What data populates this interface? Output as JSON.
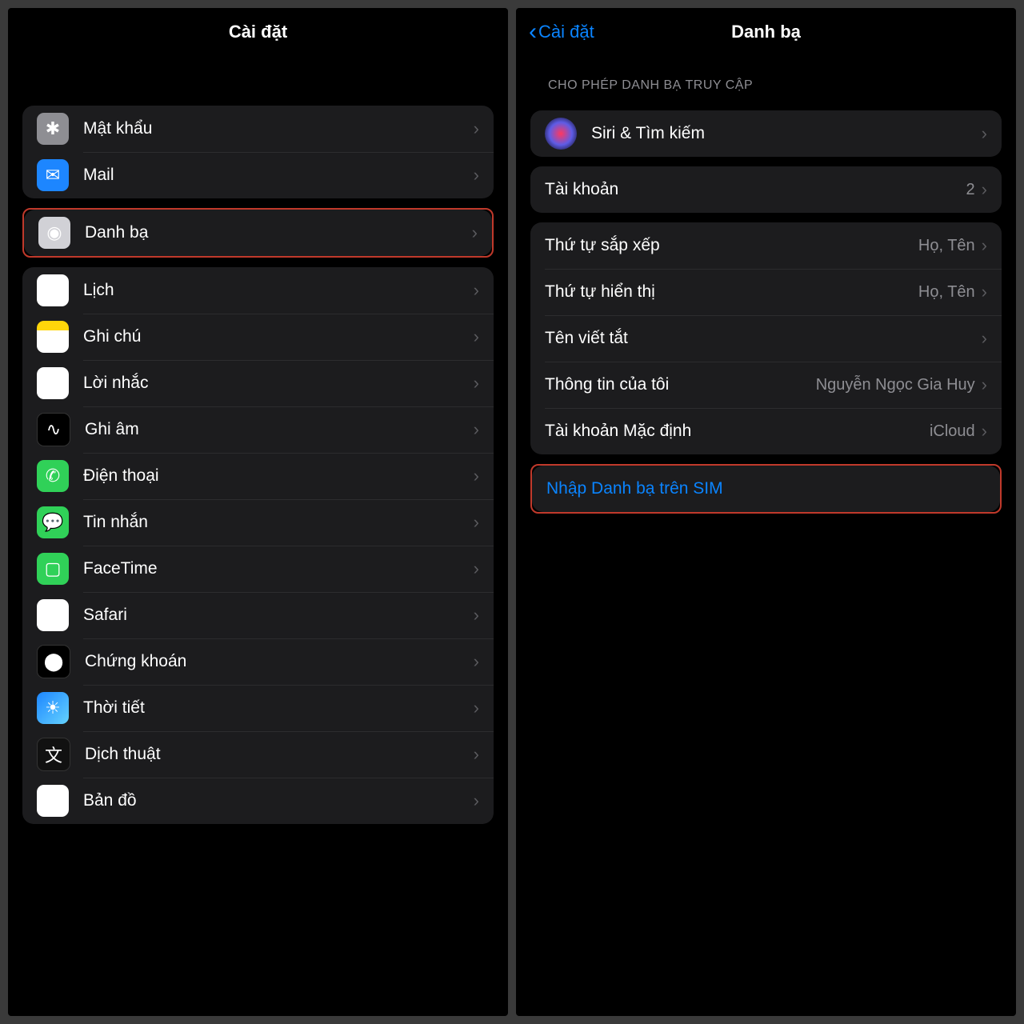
{
  "left": {
    "title": "Cài đặt",
    "items": [
      {
        "label": "Mật khẩu",
        "icon": "key-icon",
        "cls": "ic-pw",
        "glyph": "✱"
      },
      {
        "label": "Mail",
        "icon": "mail-icon",
        "cls": "ic-mail",
        "glyph": "✉"
      },
      {
        "label": "Danh bạ",
        "icon": "contacts-icon",
        "cls": "ic-contacts",
        "glyph": "◉",
        "highlight": true
      },
      {
        "label": "Lịch",
        "icon": "calendar-icon",
        "cls": "ic-cal",
        "glyph": "▦"
      },
      {
        "label": "Ghi chú",
        "icon": "notes-icon",
        "cls": "ic-notes",
        "glyph": ""
      },
      {
        "label": "Lời nhắc",
        "icon": "reminders-icon",
        "cls": "ic-rem",
        "glyph": "☰"
      },
      {
        "label": "Ghi âm",
        "icon": "voicememos-icon",
        "cls": "ic-voice",
        "glyph": "∿"
      },
      {
        "label": "Điện thoại",
        "icon": "phone-icon",
        "cls": "ic-phone",
        "glyph": "✆"
      },
      {
        "label": "Tin nhắn",
        "icon": "messages-icon",
        "cls": "ic-msg",
        "glyph": "💬"
      },
      {
        "label": "FaceTime",
        "icon": "facetime-icon",
        "cls": "ic-ft",
        "glyph": "▢"
      },
      {
        "label": "Safari",
        "icon": "safari-icon",
        "cls": "ic-safari",
        "glyph": "✪"
      },
      {
        "label": "Chứng khoán",
        "icon": "stocks-icon",
        "cls": "ic-stocks",
        "glyph": "⬤"
      },
      {
        "label": "Thời tiết",
        "icon": "weather-icon",
        "cls": "ic-weather",
        "glyph": "☀"
      },
      {
        "label": "Dịch thuật",
        "icon": "translate-icon",
        "cls": "ic-trans",
        "glyph": "文"
      },
      {
        "label": "Bản đồ",
        "icon": "maps-icon",
        "cls": "ic-maps",
        "glyph": "⌖"
      }
    ]
  },
  "right": {
    "back": "Cài đặt",
    "title": "Danh bạ",
    "section_header": "CHO PHÉP DANH BẠ TRUY CẬP",
    "siri": {
      "label": "Siri & Tìm kiếm"
    },
    "accounts": {
      "label": "Tài khoản",
      "value": "2"
    },
    "options": [
      {
        "label": "Thứ tự sắp xếp",
        "value": "Họ, Tên"
      },
      {
        "label": "Thứ tự hiển thị",
        "value": "Họ, Tên"
      },
      {
        "label": "Tên viết tắt",
        "value": ""
      },
      {
        "label": "Thông tin của tôi",
        "value": "Nguyễn Ngọc Gia Huy"
      },
      {
        "label": "Tài khoản Mặc định",
        "value": "iCloud"
      }
    ],
    "import": {
      "label": "Nhập Danh bạ trên SIM"
    }
  }
}
